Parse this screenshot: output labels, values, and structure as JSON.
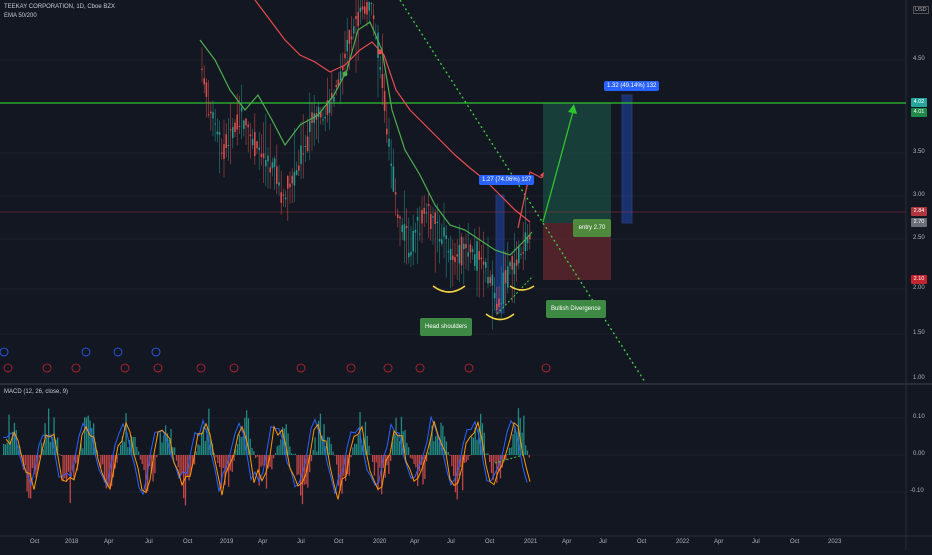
{
  "header": {
    "symbol_line": "TEEKAY CORPORATION, 1D, Cboe BZX",
    "indicator_line": "EMA 50/200",
    "currency": "USD"
  },
  "macd_header": "MACD (12, 26, close, 9)",
  "annotations": {
    "target_box": "1.32 (49.14%) 132",
    "rise_box": "1.27 (74.06%) 127",
    "entry": "entry 2.70",
    "head_shoulders": "Head shoulders",
    "divergence": "Bullish Divergence"
  },
  "price_axis": {
    "ticks": [
      "4.50",
      "3.50",
      "3.00",
      "2.50",
      "2.00",
      "1.50",
      "1.00"
    ],
    "tags": [
      {
        "label": "4.02",
        "color": "#26a69a"
      },
      {
        "label": "4.01",
        "color": "#1e8a4a"
      },
      {
        "label": "2.84",
        "color": "#b0353d"
      },
      {
        "label": "2.70",
        "color": "#6b6e78"
      },
      {
        "label": "2.10",
        "color": "#c2252f"
      }
    ]
  },
  "macd_axis": {
    "ticks": [
      "0.10",
      "0.00",
      "-0.10"
    ]
  },
  "time_axis": {
    "ticks": [
      "Oct",
      "2018",
      "Apr",
      "Jul",
      "Oct",
      "2019",
      "Apr",
      "Jul",
      "Oct",
      "2020",
      "Apr",
      "Jul",
      "Oct",
      "2021",
      "Apr",
      "Jul",
      "Oct",
      "2022",
      "Apr",
      "Jul",
      "Oct",
      "2023"
    ]
  },
  "colors": {
    "background": "#131722",
    "ema_fast": "#4caf50",
    "ema_slow": "#e84c4c",
    "candle_up": "#26a69a",
    "candle_down": "#ef5350",
    "resistance": "#2fc42f",
    "trendline": "#3fd43f",
    "target_zone": "#1b5e4a",
    "stop_zone": "#6b2a2e",
    "macd_line": "#2962ff",
    "signal_line": "#ff9800",
    "hist_up": "#26a69a",
    "hist_down": "#ef5350"
  }
}
